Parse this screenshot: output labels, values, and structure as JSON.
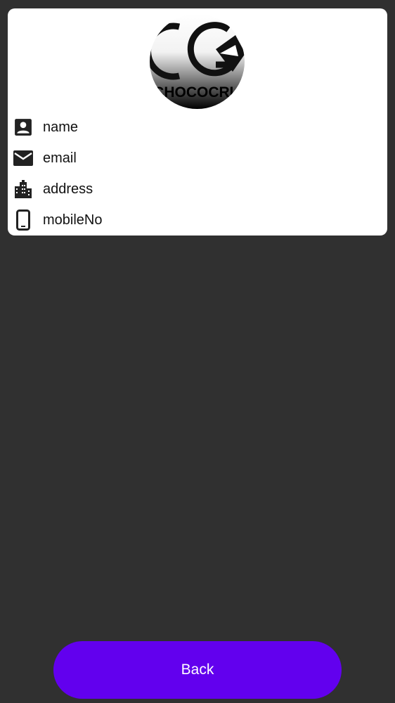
{
  "profile": {
    "logo_text": "CHOCOCRU",
    "logo_letters": "CG",
    "fields": [
      {
        "icon": "contact-card-icon",
        "label": "name"
      },
      {
        "icon": "mail-icon",
        "label": "email"
      },
      {
        "icon": "city-icon",
        "label": "address"
      },
      {
        "icon": "smartphone-icon",
        "label": "mobileNo"
      }
    ]
  },
  "actions": {
    "back_label": "Back"
  },
  "colors": {
    "background": "#303030",
    "card": "#ffffff",
    "accent": "#6200ee"
  }
}
